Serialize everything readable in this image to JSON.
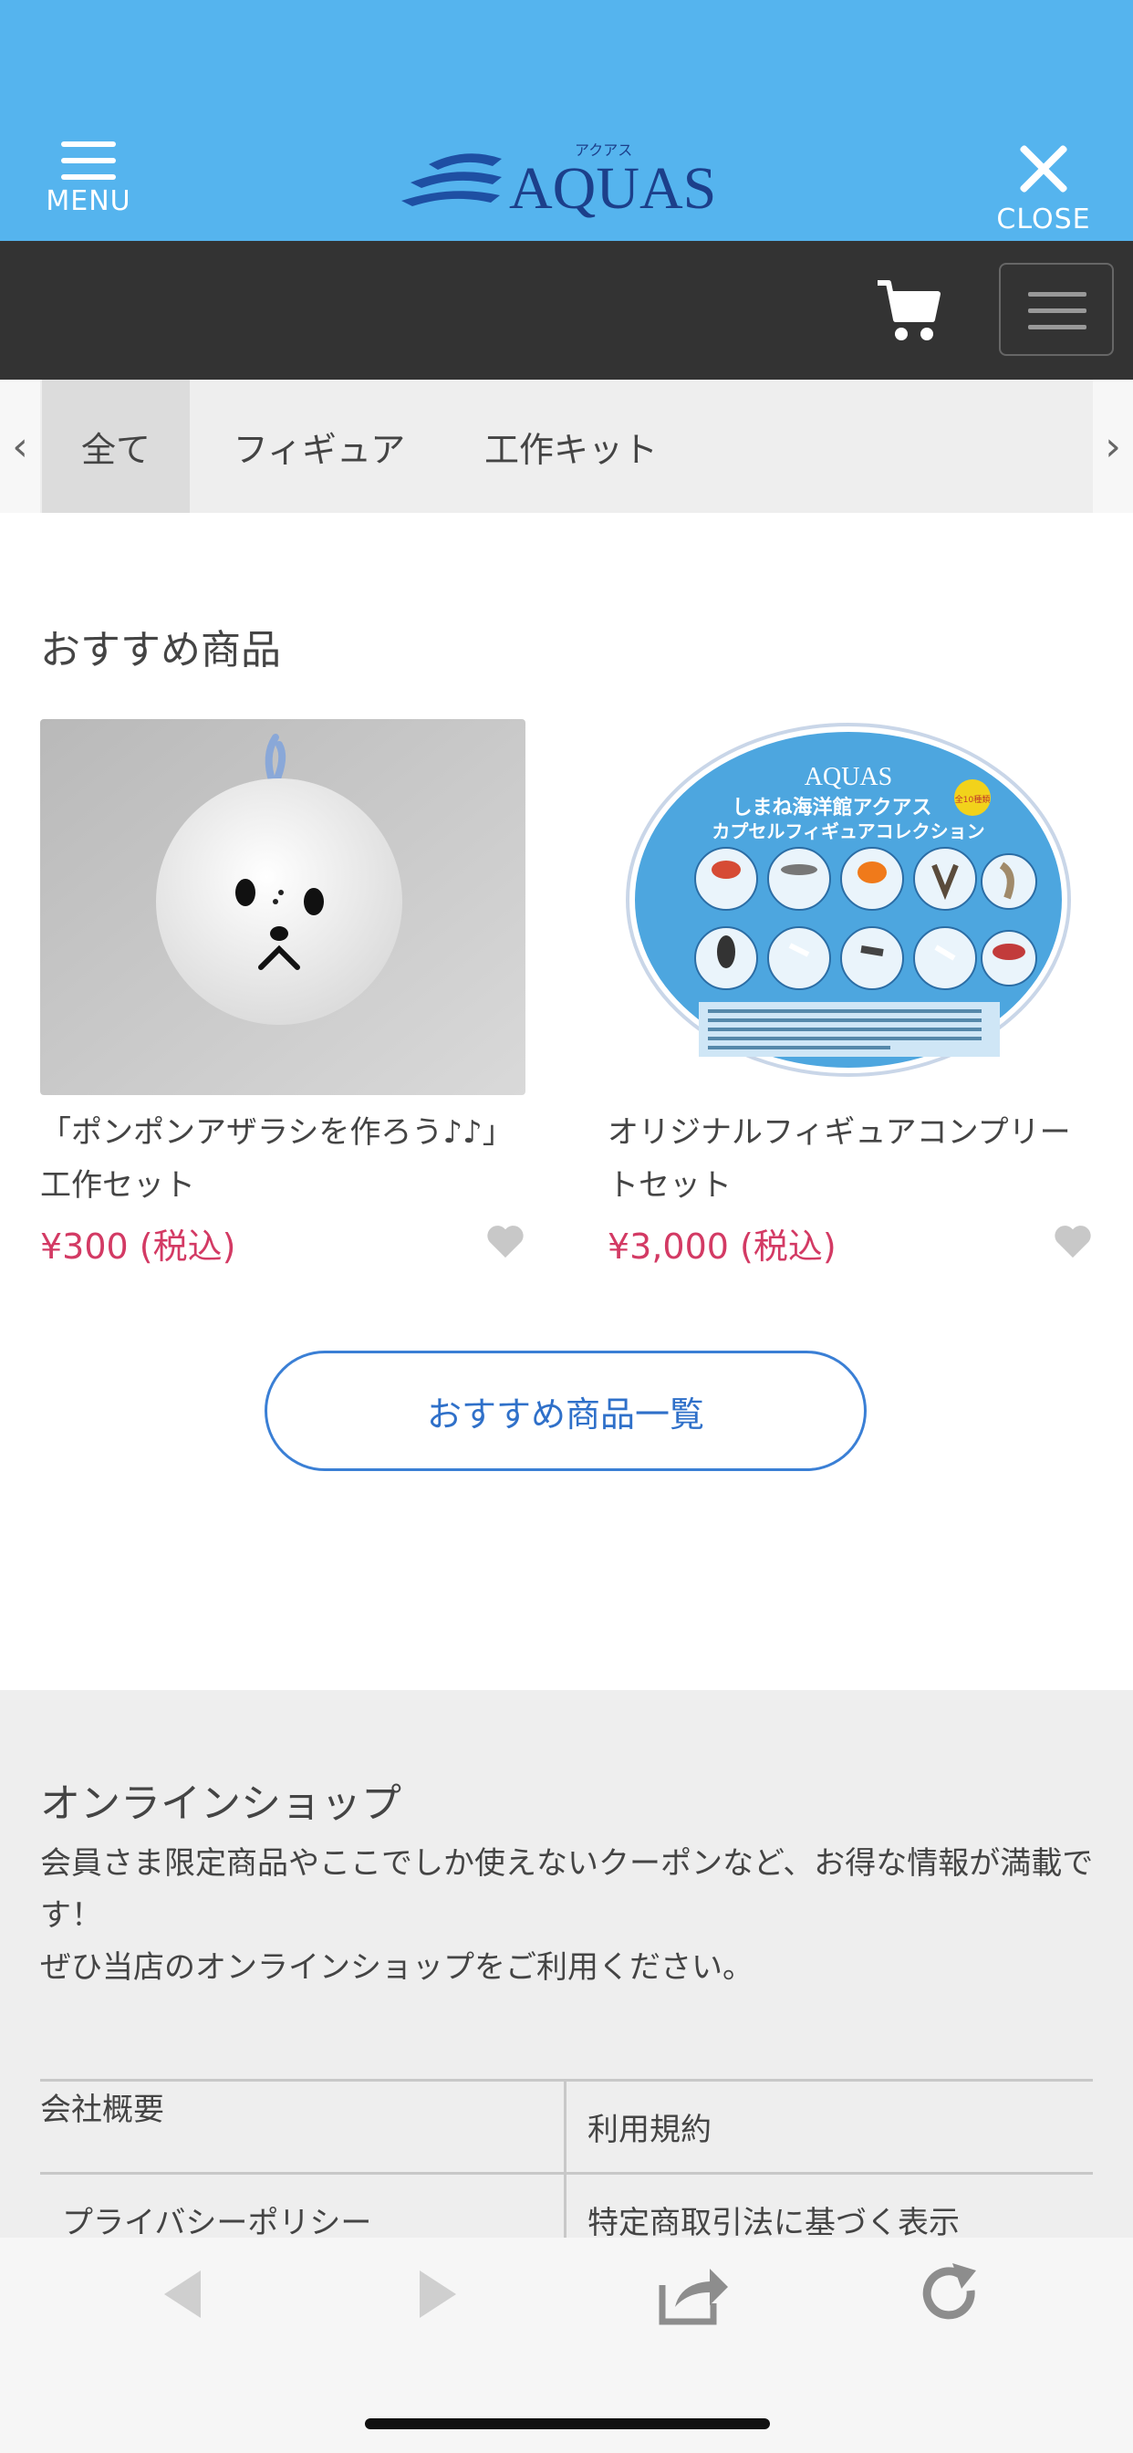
{
  "header": {
    "menu_label": "MENU",
    "close_label": "CLOSE",
    "logo_text": "AQUAS",
    "logo_kana": "アクアス",
    "bg_color": "#55b4ee"
  },
  "nav_bar": {
    "cart_icon": "cart-icon",
    "menu_icon": "hamburger-icon"
  },
  "categories": {
    "tabs": [
      {
        "label": "全て",
        "active": true
      },
      {
        "label": "フィギュア",
        "active": false
      },
      {
        "label": "工作キット",
        "active": false
      }
    ]
  },
  "recommended": {
    "title": "おすすめ商品",
    "products": [
      {
        "name": "「ポンポンアザラシを作ろう♪♪」工作セット",
        "price": "¥300 (税込)"
      },
      {
        "name": "オリジナルフィギュアコンプリートセット",
        "price": "¥3,000 (税込)",
        "image_text_title": "しまね海洋館アクアス",
        "image_text_subtitle": "カプセルフィギュアコレクション",
        "image_badge": "全10種類"
      }
    ],
    "list_button": "おすすめ商品一覧",
    "price_color": "#d33a64"
  },
  "footer": {
    "title": "オンラインショップ",
    "text_line1": "会員さま限定商品やここでしか使えないクーポンなど、お得な情報が満載です！",
    "text_line2": "ぜひ当店のオンラインショップをご利用ください。",
    "links": [
      "会社概要",
      "利用規約",
      "プライバシーポリシー",
      "特定商取引法に基づく表示"
    ]
  }
}
